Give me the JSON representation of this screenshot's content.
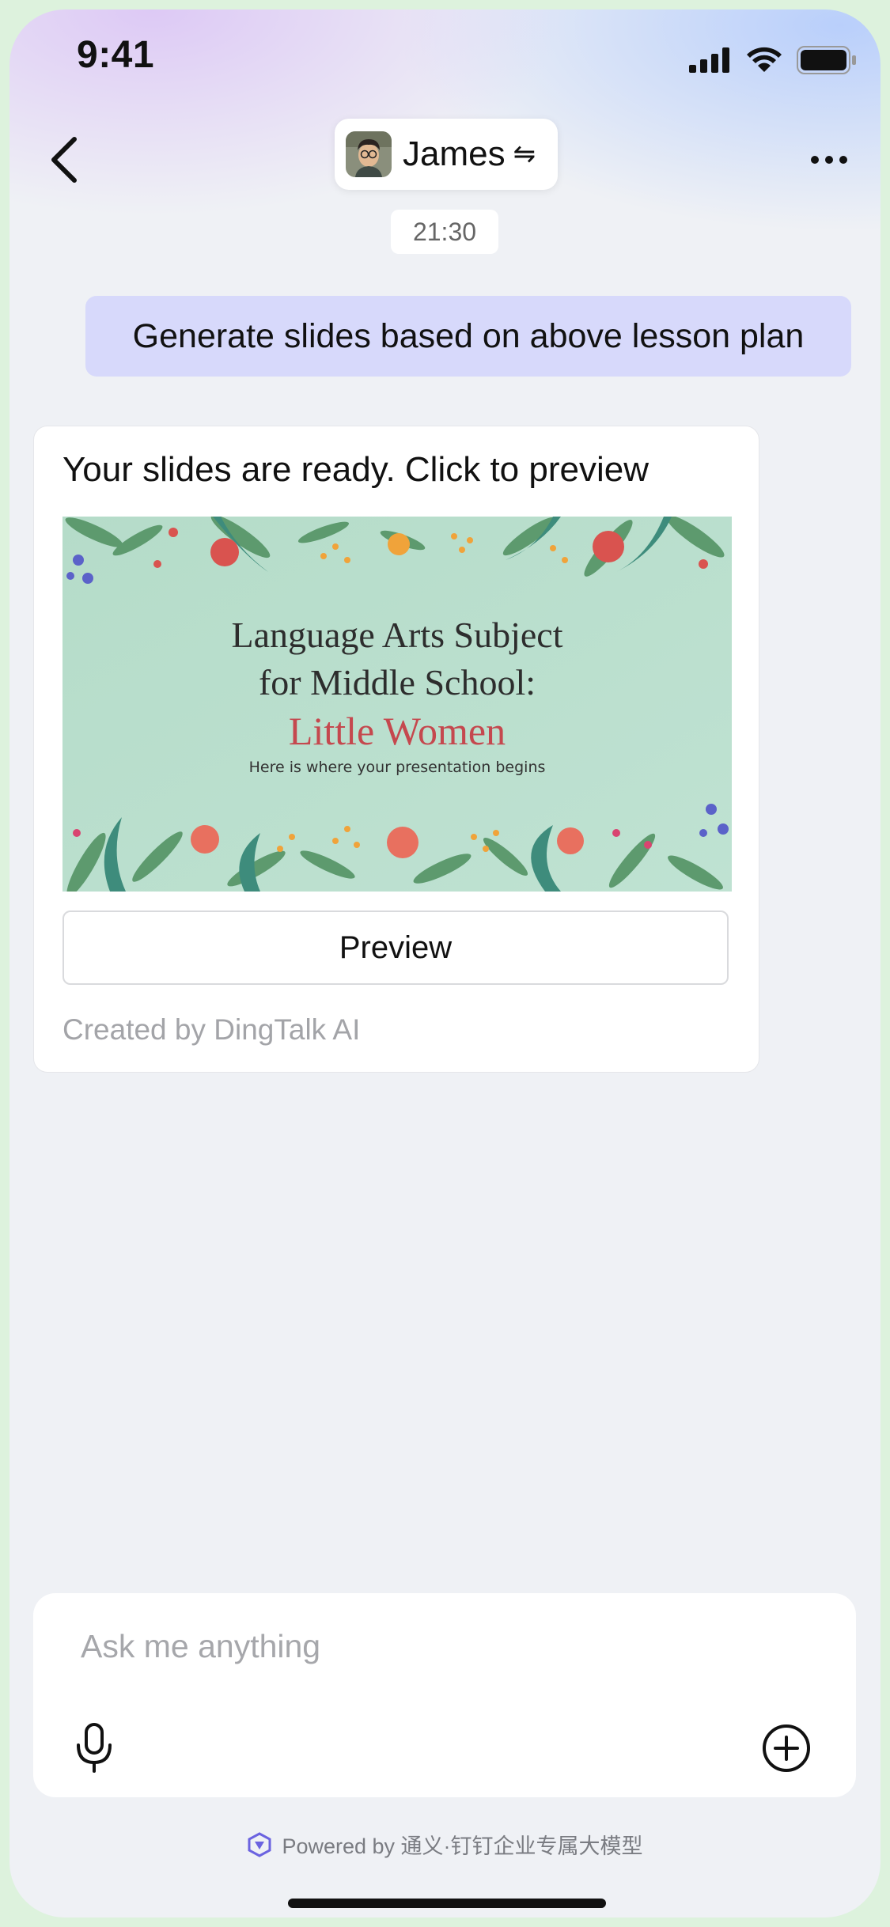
{
  "status_bar": {
    "time": "9:41"
  },
  "header": {
    "contact_name": "James",
    "swap_glyph": "⇋"
  },
  "chat": {
    "timestamp": "21:30",
    "user_message": "Generate slides based on above lesson plan",
    "ai_card": {
      "title": "Your slides are ready. Click to preview",
      "slide": {
        "title_line1": "Language Arts Subject",
        "title_line2": "for Middle School:",
        "title_accent": "Little Women",
        "subtitle": "Here is where your presentation begins"
      },
      "preview_label": "Preview",
      "footer": "Created by DingTalk AI"
    }
  },
  "composer": {
    "placeholder": "Ask me anything"
  },
  "powered_by": "Powered by 通义·钉钉企业专属大模型",
  "colors": {
    "user_bubble": "#d7d9fb",
    "accent_red": "#c5484e",
    "slide_bg": "#b7dccb"
  },
  "icons": [
    "back-arrow-icon",
    "more-icon",
    "mic-icon",
    "plus-circle-icon",
    "signal-icon",
    "wifi-icon",
    "battery-icon",
    "tongyi-logo-icon"
  ]
}
